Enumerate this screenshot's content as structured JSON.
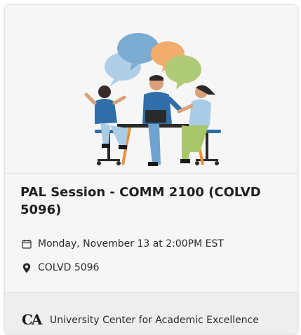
{
  "event": {
    "title": "PAL Session - COMM 2100 (COLVD 5096)",
    "datetime": "Monday, November 13 at 2:00PM EST",
    "location": "COLVD 5096"
  },
  "organization": {
    "name": "University Center for Academic Excellence",
    "logo_text": "CA"
  },
  "icons": {
    "date": "calendar-icon",
    "location": "map-pin-icon"
  },
  "colors": {
    "bubble_blue": "#6fa3cf",
    "bubble_orange": "#f2a55c",
    "bubble_green": "#a9c76a",
    "bubble_light_blue": "#a9cbe6",
    "person_blue": "#2f6ea8",
    "table_orange": "#e8913a"
  }
}
